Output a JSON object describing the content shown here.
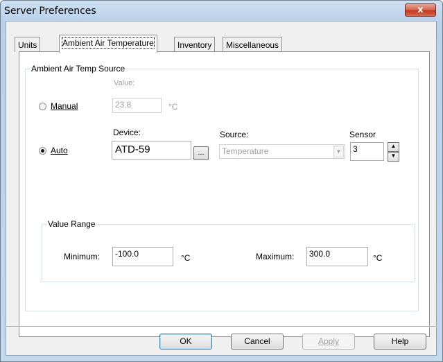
{
  "window": {
    "title": "Server Preferences",
    "close_glyph": "x"
  },
  "tabs": [
    {
      "label": "Units",
      "active": false
    },
    {
      "label": "Ambient Air Temperature",
      "active": true
    },
    {
      "label": "Inventory",
      "active": false
    },
    {
      "label": "Miscellaneous",
      "active": false
    }
  ],
  "source_group": {
    "legend": "Ambient Air Temp Source",
    "manual": {
      "label": "Manual",
      "selected": false,
      "value_label": "Value:",
      "value": "23.8",
      "unit": "°C"
    },
    "auto": {
      "label": "Auto",
      "selected": true,
      "device_label": "Device:",
      "device_value": "ATD-59",
      "browse_label": "...",
      "source_label": "Source:",
      "source_value": "Temperature",
      "sensor_label": "Sensor",
      "sensor_value": "3"
    }
  },
  "range_group": {
    "legend": "Value Range",
    "min_label": "Minimum:",
    "min_value": "-100.0",
    "min_unit": "°C",
    "max_label": "Maximum:",
    "max_value": "300.0",
    "max_unit": "°C"
  },
  "buttons": {
    "ok": "OK",
    "cancel": "Cancel",
    "apply": "Apply",
    "help": "Help"
  },
  "colors": {
    "disabled_text": "#a0a0a0",
    "close_button": "#c2381f"
  }
}
